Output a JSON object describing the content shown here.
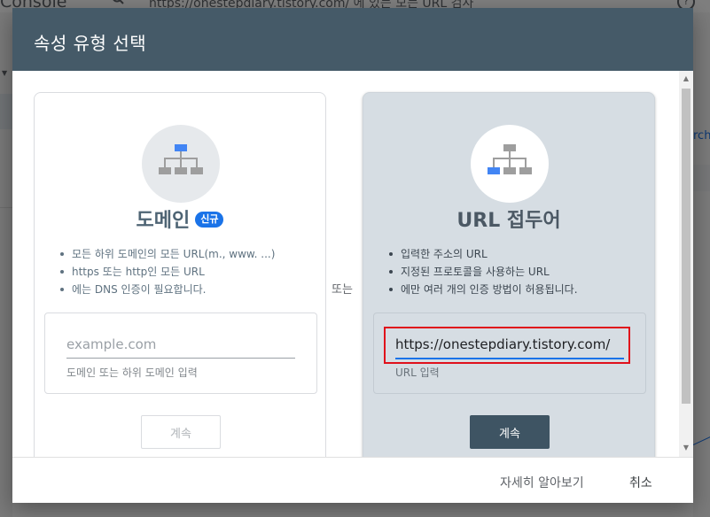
{
  "background": {
    "brand": "Console",
    "search_text": "https://onestepdiary.tistory.com/ 에 있는 모든 URL 검사",
    "help_glyph": "?",
    "right_link_fragment": "rch"
  },
  "dialog": {
    "title": "속성 유형 선택",
    "or_label": "또는",
    "domain": {
      "title": "도메인",
      "badge": "신규",
      "bullets": [
        "모든 하위 도메인의 모든 URL(m., www. ...)",
        "https 또는 http인 모든 URL",
        "에는 DNS 인증이 필요합니다."
      ],
      "input_placeholder": "example.com",
      "input_value": "",
      "input_helper": "도메인 또는 하위 도메인 입력",
      "continue_label": "계속",
      "icon": "sitemap-icon"
    },
    "url_prefix": {
      "title": "URL 접두어",
      "bullets": [
        "입력한 주소의 URL",
        "지정된 프로토콜을 사용하는 URL",
        "에만 여러 개의 인증 방법이 허용됩니다."
      ],
      "input_value": "https://onestepdiary.tistory.com/",
      "input_helper": "URL 입력",
      "continue_label": "계속",
      "icon": "sitemap-icon"
    },
    "footer": {
      "learn_more": "자세히 알아보기",
      "cancel": "취소"
    }
  },
  "colors": {
    "header": "#455a68",
    "accent": "#1a73e8",
    "highlight": "#e0101b",
    "selected_card": "#d6dde3",
    "continue_active": "#3e5463"
  }
}
